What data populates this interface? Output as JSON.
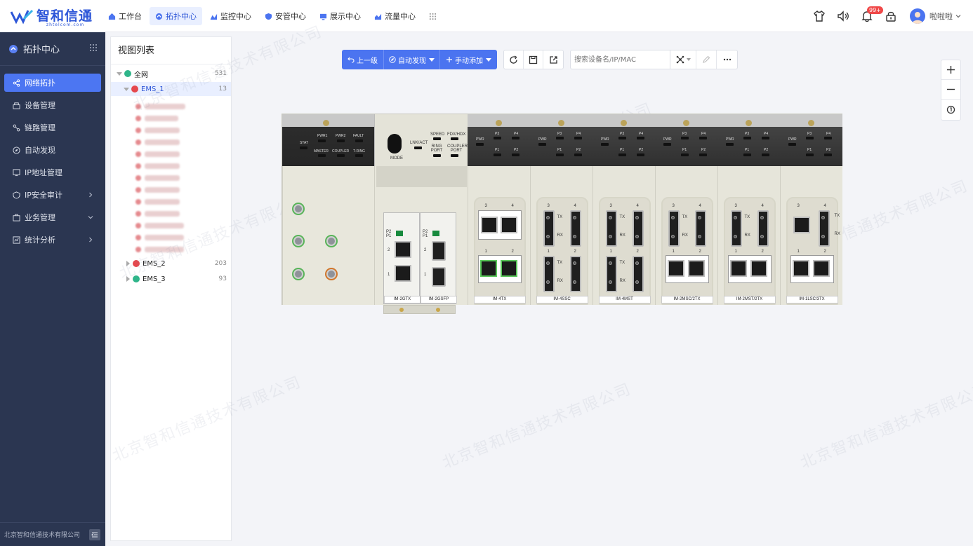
{
  "app": {
    "brand": "智和信通",
    "brand_sub": "zhtelcom.com"
  },
  "topnav": [
    {
      "label": "工作台",
      "icon": "home-icon"
    },
    {
      "label": "拓扑中心",
      "icon": "topology-icon",
      "active": true
    },
    {
      "label": "监控中心",
      "icon": "monitor-icon"
    },
    {
      "label": "安管中心",
      "icon": "shield-icon"
    },
    {
      "label": "展示中心",
      "icon": "display-icon"
    },
    {
      "label": "流量中心",
      "icon": "traffic-icon"
    }
  ],
  "header": {
    "notification_badge": "99+",
    "username": "啦啦啦"
  },
  "sidebar": {
    "title": "拓扑中心",
    "items": [
      {
        "label": "网络拓扑",
        "active": true
      },
      {
        "label": "设备管理"
      },
      {
        "label": "链路管理"
      },
      {
        "label": "自动发现"
      },
      {
        "label": "IP地址管理"
      },
      {
        "label": "IP安全审计",
        "arrow": "right"
      },
      {
        "label": "业务管理",
        "arrow": "down"
      },
      {
        "label": "统计分析",
        "arrow": "right"
      }
    ],
    "footer": "北京智和信通技术有限公司"
  },
  "tree": {
    "title": "视图列表",
    "nodes": [
      {
        "label": "全网",
        "count": "531"
      },
      {
        "label": "EMS_1",
        "count": "13"
      },
      {
        "label": "EMS_2",
        "count": "203"
      },
      {
        "label": "EMS_3",
        "count": "93"
      }
    ]
  },
  "toolbar": {
    "up_label": "上一级",
    "discover_label": "自动发现",
    "add_label": "手动添加",
    "search_placeholder": "搜索设备名/IP/MAC"
  },
  "watermark": "北京智和信通技术有限公司",
  "device": {
    "front_labels": {
      "stat": "STAT",
      "pwr1": "PWR1",
      "pwr2": "PWR2",
      "fault": "FAULT",
      "master": "MASTER",
      "coupler": "COUPLER",
      "tring": "T-RING",
      "mode": "MODE",
      "lnkact": "LNK/ACT",
      "speed": "SPEED",
      "fdxhdx": "FDX/HDX",
      "ring_port": "RING PORT",
      "coupler_port": "COUPLER PORT"
    },
    "modules": [
      "IM-2GTX",
      "IM-2GSFP",
      "IM-4TX",
      "IM-4SSC",
      "IM-4MST",
      "IM-2MSC/2TX",
      "IM-2MST/2TX",
      "IM-1LSC/3TX"
    ],
    "port_labels": {
      "pwr": "PWR",
      "p1": "P1",
      "p2": "P2",
      "p3": "P3",
      "p4": "P4",
      "tx": "TX",
      "rx": "RX",
      "n1": "1",
      "n2": "2",
      "n3": "3",
      "n4": "4"
    }
  }
}
